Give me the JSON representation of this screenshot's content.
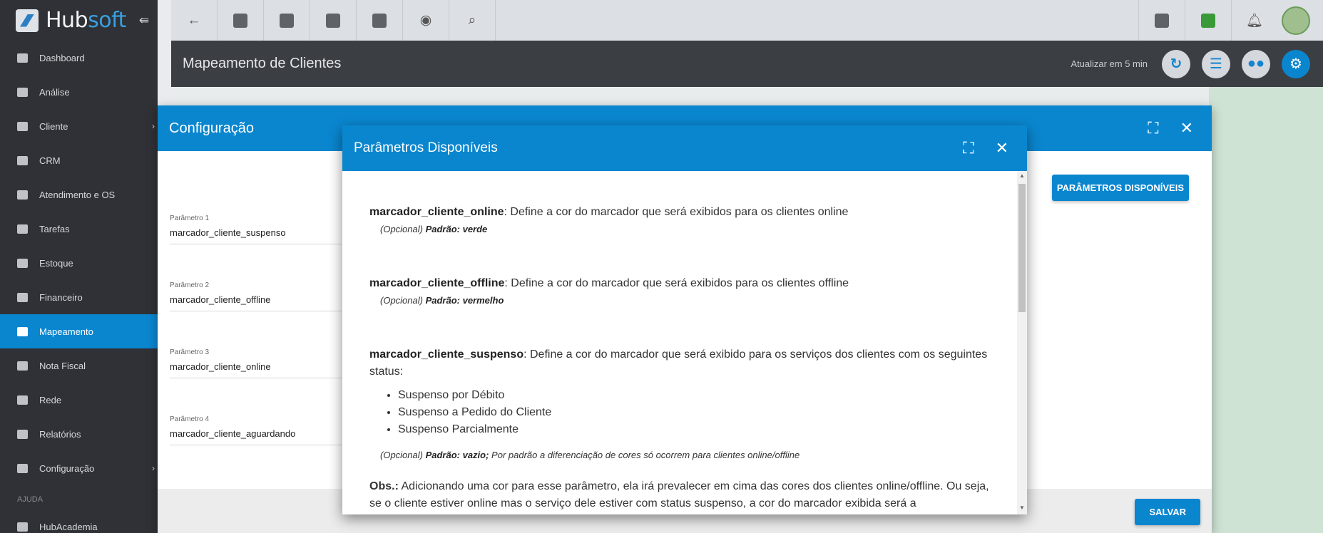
{
  "brand": {
    "name_main": "Hub",
    "name_accent": "soft"
  },
  "sidebar": {
    "items": [
      {
        "label": "Dashboard",
        "icon": "dashboard-icon"
      },
      {
        "label": "Análise",
        "icon": "chart-pie-icon"
      },
      {
        "label": "Cliente",
        "icon": "client-card-icon",
        "has_children": true
      },
      {
        "label": "CRM",
        "icon": "crm-icon"
      },
      {
        "label": "Atendimento e OS",
        "icon": "calendar-clock-icon"
      },
      {
        "label": "Tarefas",
        "icon": "tasks-icon"
      },
      {
        "label": "Estoque",
        "icon": "box-icon"
      },
      {
        "label": "Financeiro",
        "icon": "money-icon"
      },
      {
        "label": "Mapeamento",
        "icon": "map-pin-icon",
        "active": true
      },
      {
        "label": "Nota Fiscal",
        "icon": "invoice-icon"
      },
      {
        "label": "Rede",
        "icon": "network-icon"
      },
      {
        "label": "Relatórios",
        "icon": "report-icon"
      },
      {
        "label": "Configuração",
        "icon": "gear-icon",
        "has_children": true
      }
    ],
    "section_label": "AJUDA",
    "help_items": [
      {
        "label": "HubAcademia",
        "icon": "academy-icon"
      }
    ]
  },
  "header": {
    "title": "Mapeamento de Clientes",
    "refresh_label": "Atualizar em 5 min"
  },
  "config_modal": {
    "title": "Configuração",
    "params_button": "PARÂMETROS DISPONÍVEIS",
    "save_button": "SALVAR",
    "params": [
      {
        "label": "Parâmetro 1",
        "value": "marcador_cliente_suspenso"
      },
      {
        "label": "Parâmetro 2",
        "value": "marcador_cliente_offline"
      },
      {
        "label": "Parâmetro 3",
        "value": "marcador_cliente_online"
      },
      {
        "label": "Parâmetro 4",
        "value": "marcador_cliente_aguardando"
      }
    ]
  },
  "params_modal": {
    "title": "Parâmetros Disponíveis",
    "e1": {
      "name": "marcador_cliente_online",
      "desc": ": Define a cor do marcador que será exibidos para os clientes online",
      "opt": "(Opcional) ",
      "def": "Padrão: verde"
    },
    "e2": {
      "name": "marcador_cliente_offline",
      "desc": ": Define a cor do marcador que será exibidos para os clientes offline",
      "opt": "(Opcional) ",
      "def": "Padrão: vermelho"
    },
    "e3": {
      "name": "marcador_cliente_suspenso",
      "desc": ": Define a cor do marcador que será exibido para os serviços dos clientes com os seguintes status:",
      "statuses": [
        "Suspenso por Débito",
        "Suspenso a Pedido do Cliente",
        "Suspenso Parcialmente"
      ],
      "opt": "(Opcional) ",
      "def": "Padrão: vazio;",
      "note": " Por padrão a diferenciação de cores só ocorrem para clientes online/offline"
    },
    "obs": {
      "label": "Obs.:",
      "text": " Adicionando uma cor para esse parâmetro, ela irá prevalecer em cima das cores dos clientes online/offline. Ou seja, se o cliente estiver online mas o serviço dele estiver com status suspenso, a cor do marcador exibida será a"
    }
  },
  "colors": {
    "primary": "#0a86cf",
    "sidebar_bg": "#2f3136",
    "header_bg": "#3b3e43"
  }
}
